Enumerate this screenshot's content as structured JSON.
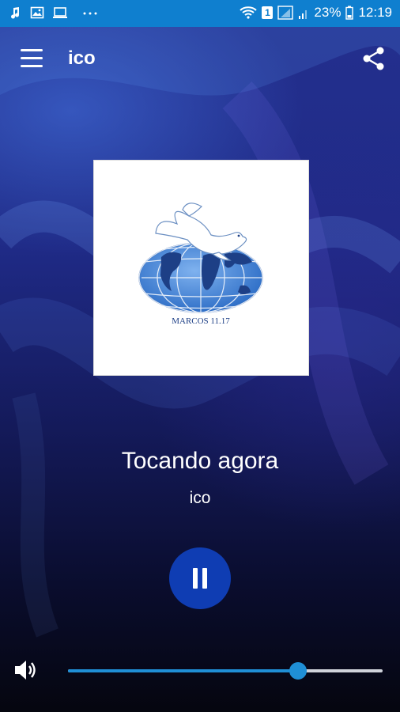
{
  "status_bar": {
    "battery": "23%",
    "time": "12:19",
    "sim_badge": "1",
    "background": "#0f7fcf"
  },
  "app_bar": {
    "title": "ico",
    "menu_icon": "hamburger-menu-icon",
    "share_icon": "share-icon"
  },
  "artwork": {
    "logo_text": "MARCOS 11.17"
  },
  "player": {
    "now_playing_label": "Tocando agora",
    "station": "ico",
    "play_state_icon": "pause-icon",
    "button_color": "#0f3db3"
  },
  "volume": {
    "icon": "speaker-icon",
    "level": 0.73,
    "accent": "#1f8fd6"
  }
}
